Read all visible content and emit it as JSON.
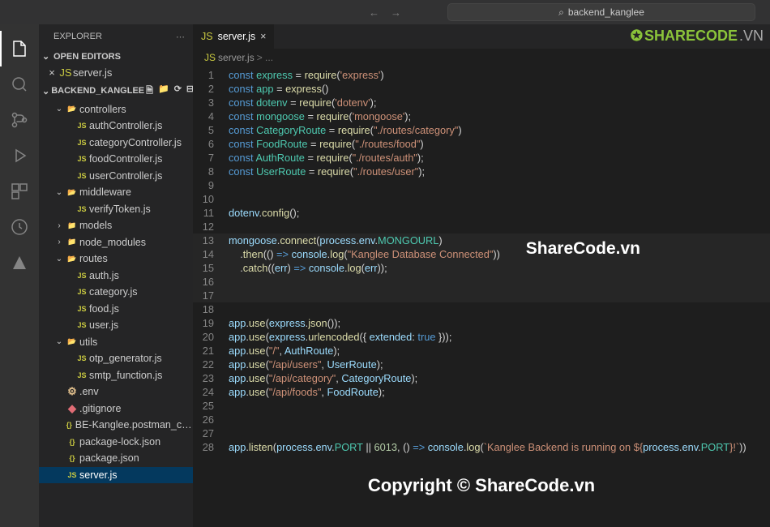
{
  "titlebar": {
    "search": "backend_kanglee"
  },
  "watermark": {
    "logo": "SHARECODE.VN",
    "center": "ShareCode.vn",
    "bottom": "Copyright © ShareCode.vn"
  },
  "sidebar": {
    "title": "EXPLORER",
    "open_editors": "OPEN EDITORS",
    "open_file": "server.js",
    "project": "BACKEND_KANGLEE"
  },
  "tree": [
    {
      "label": "controllers",
      "type": "folder-open",
      "indent": 1,
      "chev": "v"
    },
    {
      "label": "authController.js",
      "type": "js",
      "indent": 2
    },
    {
      "label": "categoryController.js",
      "type": "js",
      "indent": 2
    },
    {
      "label": "foodController.js",
      "type": "js",
      "indent": 2
    },
    {
      "label": "userController.js",
      "type": "js",
      "indent": 2
    },
    {
      "label": "middleware",
      "type": "folder-mid",
      "indent": 1,
      "chev": "v"
    },
    {
      "label": "verifyToken.js",
      "type": "js",
      "indent": 2
    },
    {
      "label": "models",
      "type": "folder-db",
      "indent": 1,
      "chev": ">"
    },
    {
      "label": "node_modules",
      "type": "folder-c",
      "indent": 1,
      "chev": ">"
    },
    {
      "label": "routes",
      "type": "folder-routes",
      "indent": 1,
      "chev": "v"
    },
    {
      "label": "auth.js",
      "type": "js",
      "indent": 2
    },
    {
      "label": "category.js",
      "type": "js",
      "indent": 2
    },
    {
      "label": "food.js",
      "type": "js",
      "indent": 2
    },
    {
      "label": "user.js",
      "type": "js",
      "indent": 2
    },
    {
      "label": "utils",
      "type": "folder-utils",
      "indent": 1,
      "chev": "v"
    },
    {
      "label": "otp_generator.js",
      "type": "js",
      "indent": 2
    },
    {
      "label": "smtp_function.js",
      "type": "js",
      "indent": 2
    },
    {
      "label": ".env",
      "type": "env",
      "indent": 1
    },
    {
      "label": ".gitignore",
      "type": "git",
      "indent": 1
    },
    {
      "label": "BE-Kanglee.postman_collecti...",
      "type": "json-br",
      "indent": 1
    },
    {
      "label": "package-lock.json",
      "type": "json",
      "indent": 1
    },
    {
      "label": "package.json",
      "type": "json",
      "indent": 1
    },
    {
      "label": "server.js",
      "type": "js",
      "indent": 1,
      "selected": true
    }
  ],
  "tab": {
    "label": "server.js"
  },
  "breadcrumb": {
    "file": "server.js",
    "sep": "> ..."
  },
  "code": [
    {
      "n": 1,
      "seg": [
        [
          "k",
          "const "
        ],
        [
          "c",
          "express"
        ],
        [
          "p",
          " = "
        ],
        [
          "f",
          "require"
        ],
        [
          "p",
          "("
        ],
        [
          "s",
          "'express'"
        ],
        [
          "p",
          ")"
        ]
      ]
    },
    {
      "n": 2,
      "seg": [
        [
          "k",
          "const "
        ],
        [
          "c",
          "app"
        ],
        [
          "p",
          " = "
        ],
        [
          "f",
          "express"
        ],
        [
          "p",
          "()"
        ]
      ]
    },
    {
      "n": 3,
      "seg": [
        [
          "k",
          "const "
        ],
        [
          "c",
          "dotenv"
        ],
        [
          "p",
          " = "
        ],
        [
          "f",
          "require"
        ],
        [
          "p",
          "("
        ],
        [
          "s",
          "'dotenv'"
        ],
        [
          "p",
          ");"
        ]
      ]
    },
    {
      "n": 4,
      "seg": [
        [
          "k",
          "const "
        ],
        [
          "c",
          "mongoose"
        ],
        [
          "p",
          " = "
        ],
        [
          "f",
          "require"
        ],
        [
          "p",
          "("
        ],
        [
          "s",
          "'mongoose'"
        ],
        [
          "p",
          ");"
        ]
      ]
    },
    {
      "n": 5,
      "seg": [
        [
          "k",
          "const "
        ],
        [
          "c",
          "CategoryRoute"
        ],
        [
          "p",
          " = "
        ],
        [
          "f",
          "require"
        ],
        [
          "p",
          "("
        ],
        [
          "s",
          "\"./routes/category\""
        ],
        [
          "p",
          ")"
        ]
      ]
    },
    {
      "n": 6,
      "seg": [
        [
          "k",
          "const "
        ],
        [
          "c",
          "FoodRoute"
        ],
        [
          "p",
          " = "
        ],
        [
          "f",
          "require"
        ],
        [
          "p",
          "("
        ],
        [
          "s",
          "\"./routes/food\""
        ],
        [
          "p",
          ")"
        ]
      ]
    },
    {
      "n": 7,
      "seg": [
        [
          "k",
          "const "
        ],
        [
          "c",
          "AuthRoute"
        ],
        [
          "p",
          " = "
        ],
        [
          "f",
          "require"
        ],
        [
          "p",
          "("
        ],
        [
          "s",
          "\"./routes/auth\""
        ],
        [
          "p",
          ");"
        ]
      ]
    },
    {
      "n": 8,
      "seg": [
        [
          "k",
          "const "
        ],
        [
          "c",
          "UserRoute"
        ],
        [
          "p",
          " = "
        ],
        [
          "f",
          "require"
        ],
        [
          "p",
          "("
        ],
        [
          "s",
          "\"./routes/user\""
        ],
        [
          "p",
          ");"
        ]
      ]
    },
    {
      "n": 9,
      "seg": []
    },
    {
      "n": 10,
      "seg": []
    },
    {
      "n": 11,
      "seg": [
        [
          "v",
          "dotenv"
        ],
        [
          "p",
          "."
        ],
        [
          "f",
          "config"
        ],
        [
          "p",
          "();"
        ]
      ]
    },
    {
      "n": 12,
      "seg": []
    },
    {
      "n": 13,
      "seg": [
        [
          "v",
          "mongoose"
        ],
        [
          "p",
          "."
        ],
        [
          "f",
          "connect"
        ],
        [
          "p",
          "("
        ],
        [
          "v",
          "process"
        ],
        [
          "p",
          "."
        ],
        [
          "v",
          "env"
        ],
        [
          "p",
          "."
        ],
        [
          "c",
          "MONGOURL"
        ],
        [
          "p",
          ")"
        ]
      ],
      "hl": true
    },
    {
      "n": 14,
      "seg": [
        [
          "p",
          "    ."
        ],
        [
          "f",
          "then"
        ],
        [
          "p",
          "(() "
        ],
        [
          "k",
          "=>"
        ],
        [
          "p",
          " "
        ],
        [
          "v",
          "console"
        ],
        [
          "p",
          "."
        ],
        [
          "f",
          "log"
        ],
        [
          "p",
          "("
        ],
        [
          "s",
          "\"Kanglee Database Connected\""
        ],
        [
          "p",
          "))"
        ]
      ],
      "hl": true
    },
    {
      "n": 15,
      "seg": [
        [
          "p",
          "    ."
        ],
        [
          "f",
          "catch"
        ],
        [
          "p",
          "(("
        ],
        [
          "v",
          "err"
        ],
        [
          "p",
          ") "
        ],
        [
          "k",
          "=>"
        ],
        [
          "p",
          " "
        ],
        [
          "v",
          "console"
        ],
        [
          "p",
          "."
        ],
        [
          "f",
          "log"
        ],
        [
          "p",
          "("
        ],
        [
          "v",
          "err"
        ],
        [
          "p",
          "));"
        ]
      ],
      "hl": true
    },
    {
      "n": 16,
      "seg": [],
      "hl": true
    },
    {
      "n": 17,
      "seg": [],
      "hl": true
    },
    {
      "n": 18,
      "seg": []
    },
    {
      "n": 19,
      "seg": [
        [
          "v",
          "app"
        ],
        [
          "p",
          "."
        ],
        [
          "f",
          "use"
        ],
        [
          "p",
          "("
        ],
        [
          "v",
          "express"
        ],
        [
          "p",
          "."
        ],
        [
          "f",
          "json"
        ],
        [
          "p",
          "());"
        ]
      ]
    },
    {
      "n": 20,
      "seg": [
        [
          "v",
          "app"
        ],
        [
          "p",
          "."
        ],
        [
          "f",
          "use"
        ],
        [
          "p",
          "("
        ],
        [
          "v",
          "express"
        ],
        [
          "p",
          "."
        ],
        [
          "f",
          "urlencoded"
        ],
        [
          "p",
          "({ "
        ],
        [
          "v",
          "extended"
        ],
        [
          "p",
          ": "
        ],
        [
          "k",
          "true"
        ],
        [
          "p",
          " }));"
        ]
      ]
    },
    {
      "n": 21,
      "seg": [
        [
          "v",
          "app"
        ],
        [
          "p",
          "."
        ],
        [
          "f",
          "use"
        ],
        [
          "p",
          "("
        ],
        [
          "s",
          "\"/\""
        ],
        [
          "p",
          ", "
        ],
        [
          "v",
          "AuthRoute"
        ],
        [
          "p",
          ");"
        ]
      ]
    },
    {
      "n": 22,
      "seg": [
        [
          "v",
          "app"
        ],
        [
          "p",
          "."
        ],
        [
          "f",
          "use"
        ],
        [
          "p",
          "("
        ],
        [
          "s",
          "\"/api/users\""
        ],
        [
          "p",
          ", "
        ],
        [
          "v",
          "UserRoute"
        ],
        [
          "p",
          ");"
        ]
      ]
    },
    {
      "n": 23,
      "seg": [
        [
          "v",
          "app"
        ],
        [
          "p",
          "."
        ],
        [
          "f",
          "use"
        ],
        [
          "p",
          "("
        ],
        [
          "s",
          "\"/api/category\""
        ],
        [
          "p",
          ", "
        ],
        [
          "v",
          "CategoryRoute"
        ],
        [
          "p",
          ");"
        ]
      ]
    },
    {
      "n": 24,
      "seg": [
        [
          "v",
          "app"
        ],
        [
          "p",
          "."
        ],
        [
          "f",
          "use"
        ],
        [
          "p",
          "("
        ],
        [
          "s",
          "\"/api/foods\""
        ],
        [
          "p",
          ", "
        ],
        [
          "v",
          "FoodRoute"
        ],
        [
          "p",
          ");"
        ]
      ]
    },
    {
      "n": 25,
      "seg": []
    },
    {
      "n": 26,
      "seg": []
    },
    {
      "n": 27,
      "seg": []
    },
    {
      "n": 28,
      "seg": [
        [
          "v",
          "app"
        ],
        [
          "p",
          "."
        ],
        [
          "f",
          "listen"
        ],
        [
          "p",
          "("
        ],
        [
          "v",
          "process"
        ],
        [
          "p",
          "."
        ],
        [
          "v",
          "env"
        ],
        [
          "p",
          "."
        ],
        [
          "c",
          "PORT"
        ],
        [
          "p",
          " || "
        ],
        [
          "n",
          "6013"
        ],
        [
          "p",
          ", () "
        ],
        [
          "k",
          "=>"
        ],
        [
          "p",
          " "
        ],
        [
          "v",
          "console"
        ],
        [
          "p",
          "."
        ],
        [
          "f",
          "log"
        ],
        [
          "p",
          "("
        ],
        [
          "s",
          "`Kanglee Backend is running on ${"
        ],
        [
          "v",
          "process"
        ],
        [
          "p",
          "."
        ],
        [
          "v",
          "env"
        ],
        [
          "p",
          "."
        ],
        [
          "c",
          "PORT"
        ],
        [
          "s",
          "}!`"
        ],
        [
          "p",
          "))"
        ]
      ]
    }
  ]
}
